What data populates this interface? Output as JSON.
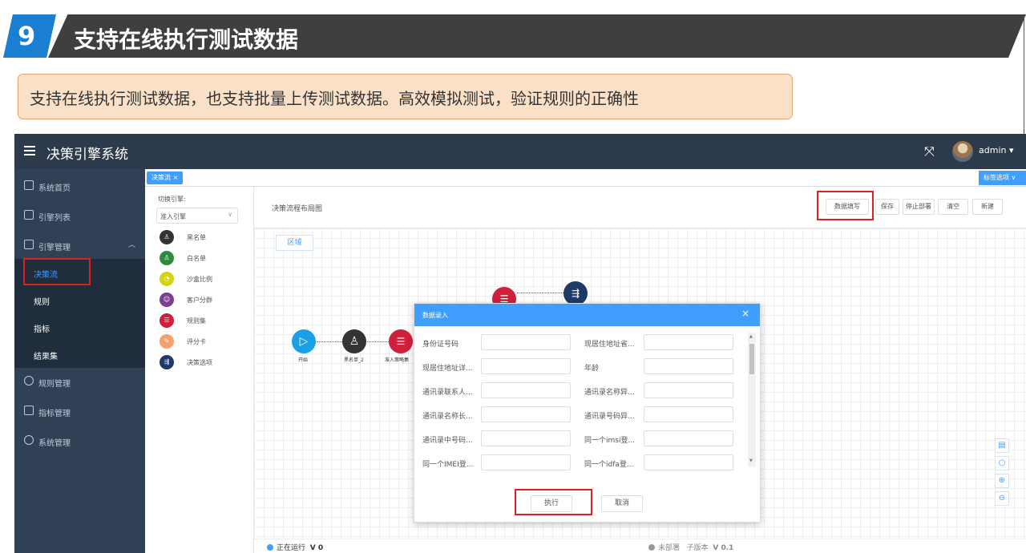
{
  "slide": {
    "number": "9",
    "title": "支持在线执行测试数据",
    "callout": "支持在线执行测试数据，也支持批量上传测试数据。高效模拟测试，验证规则的正确性",
    "colors": {
      "badge": "#1a7fd0",
      "band": "#3f3f3f",
      "callout_bg": "#fbe0c8",
      "highlight": "#e02020"
    }
  },
  "app": {
    "title": "决策引擎系统",
    "user": "admin ▾",
    "icons": {
      "menu": "menu-icon",
      "fullscreen": "fullscreen-icon"
    },
    "accent": "#409eff",
    "sidebar_bg": "#304156"
  },
  "sidebar": {
    "items": [
      {
        "label": "系统首页",
        "icon": "home-icon"
      },
      {
        "label": "引擎列表",
        "icon": "list-icon"
      },
      {
        "label": "引擎管理",
        "icon": "grid-icon",
        "expanded": true
      },
      {
        "label": "规则管理",
        "icon": "rule-icon"
      },
      {
        "label": "指标管理",
        "icon": "book-icon"
      },
      {
        "label": "系统管理",
        "icon": "gear-icon"
      }
    ],
    "sub_items": [
      {
        "label": "决策流",
        "active": true
      },
      {
        "label": "规则"
      },
      {
        "label": "指标"
      },
      {
        "label": "结果集"
      }
    ]
  },
  "tags": {
    "active_tag": "决策流 ×",
    "menu": "标签选项 ∨"
  },
  "palette": {
    "engine_label": "切换引擎:",
    "engine_value": "准入引擎",
    "items": [
      {
        "label": "黑名单",
        "color": "#333333"
      },
      {
        "label": "白名单",
        "color": "#2e8b3e"
      },
      {
        "label": "沙盒比例",
        "color": "#d4d414"
      },
      {
        "label": "客户分群",
        "color": "#7a3e8e"
      },
      {
        "label": "规则集",
        "color": "#d0203b"
      },
      {
        "label": "评分卡",
        "color": "#f3a26b"
      },
      {
        "label": "决策选项",
        "color": "#1d3b66"
      }
    ]
  },
  "flow": {
    "title": "决策流程布局图",
    "buttons": [
      "数据填写",
      "保存",
      "停止部署",
      "清空",
      "新建"
    ],
    "region": "区域",
    "nodes": [
      {
        "label": "开始",
        "color": "#1aa0e6"
      },
      {
        "label": "黑名单_2",
        "color": "#333333"
      },
      {
        "label": "准入策略集",
        "color": "#d0203b"
      }
    ],
    "zoom": [
      "doc-icon",
      "zoom-fit-icon",
      "zoom-in-icon",
      "zoom-out-icon"
    ],
    "status_running": "正在运行",
    "version_running": "V 0",
    "status_deploy": "未部署",
    "sub_version": "子版本",
    "version_sub": "V 0.1"
  },
  "modal": {
    "title": "数据录入",
    "close": "×",
    "fields": [
      "身份证号码",
      "现居住地址省...",
      "现居住地址详...",
      "年龄",
      "通讯录联系人...",
      "通讯录名称异...",
      "通讯录名称长...",
      "通讯录号码异...",
      "通讯录中号码...",
      "同一个imsi登...",
      "同一个IMEI登...",
      "同一个idfa登..."
    ],
    "execute": "执行",
    "cancel": "取消"
  }
}
